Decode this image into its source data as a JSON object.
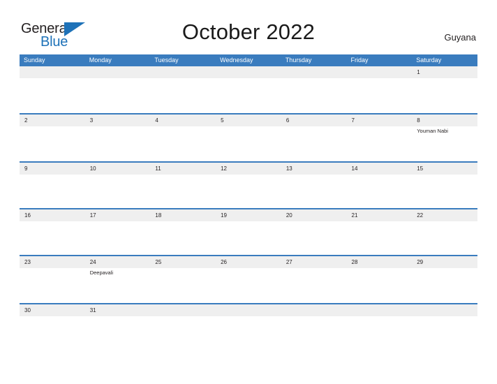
{
  "header": {
    "logo": {
      "text_primary": "General",
      "text_secondary": "Blue",
      "flag_icon": "blue-triangle-flag-icon",
      "color_primary": "#231f20",
      "color_secondary": "#1e72b8"
    },
    "title": "October 2022",
    "country": "Guyana"
  },
  "calendar": {
    "accent_color": "#3a7cbe",
    "date_band_color": "#efefef",
    "weekdays": [
      "Sunday",
      "Monday",
      "Tuesday",
      "Wednesday",
      "Thursday",
      "Friday",
      "Saturday"
    ],
    "weeks": [
      {
        "days": [
          {
            "date": "",
            "event": ""
          },
          {
            "date": "",
            "event": ""
          },
          {
            "date": "",
            "event": ""
          },
          {
            "date": "",
            "event": ""
          },
          {
            "date": "",
            "event": ""
          },
          {
            "date": "",
            "event": ""
          },
          {
            "date": "1",
            "event": ""
          }
        ]
      },
      {
        "days": [
          {
            "date": "2",
            "event": ""
          },
          {
            "date": "3",
            "event": ""
          },
          {
            "date": "4",
            "event": ""
          },
          {
            "date": "5",
            "event": ""
          },
          {
            "date": "6",
            "event": ""
          },
          {
            "date": "7",
            "event": ""
          },
          {
            "date": "8",
            "event": "Youman Nabi"
          }
        ]
      },
      {
        "days": [
          {
            "date": "9",
            "event": ""
          },
          {
            "date": "10",
            "event": ""
          },
          {
            "date": "11",
            "event": ""
          },
          {
            "date": "12",
            "event": ""
          },
          {
            "date": "13",
            "event": ""
          },
          {
            "date": "14",
            "event": ""
          },
          {
            "date": "15",
            "event": ""
          }
        ]
      },
      {
        "days": [
          {
            "date": "16",
            "event": ""
          },
          {
            "date": "17",
            "event": ""
          },
          {
            "date": "18",
            "event": ""
          },
          {
            "date": "19",
            "event": ""
          },
          {
            "date": "20",
            "event": ""
          },
          {
            "date": "21",
            "event": ""
          },
          {
            "date": "22",
            "event": ""
          }
        ]
      },
      {
        "days": [
          {
            "date": "23",
            "event": ""
          },
          {
            "date": "24",
            "event": "Deepavali"
          },
          {
            "date": "25",
            "event": ""
          },
          {
            "date": "26",
            "event": ""
          },
          {
            "date": "27",
            "event": ""
          },
          {
            "date": "28",
            "event": ""
          },
          {
            "date": "29",
            "event": ""
          }
        ]
      },
      {
        "days": [
          {
            "date": "30",
            "event": ""
          },
          {
            "date": "31",
            "event": ""
          },
          {
            "date": "",
            "event": ""
          },
          {
            "date": "",
            "event": ""
          },
          {
            "date": "",
            "event": ""
          },
          {
            "date": "",
            "event": ""
          },
          {
            "date": "",
            "event": ""
          }
        ]
      }
    ]
  }
}
